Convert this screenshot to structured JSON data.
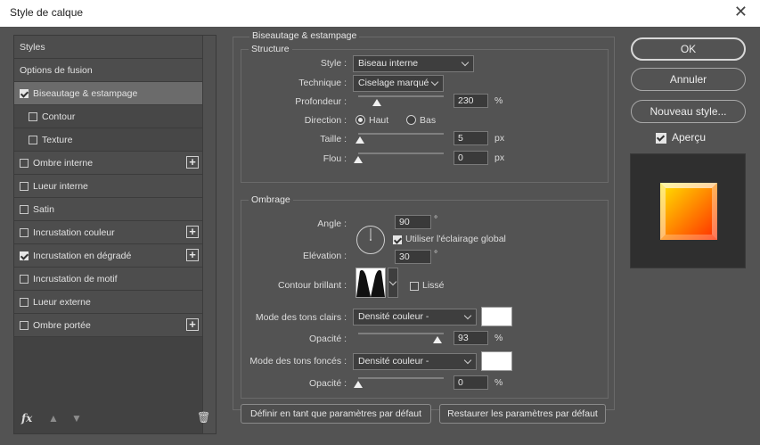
{
  "window": {
    "title": "Style de calque",
    "close_glyph": "✕"
  },
  "styles_list": {
    "items": [
      {
        "label": "Styles",
        "checkbox": false,
        "checked": false,
        "plus": false,
        "sub": false,
        "selected": false
      },
      {
        "label": "Options de fusion",
        "checkbox": false,
        "checked": false,
        "plus": false,
        "sub": false,
        "selected": false
      },
      {
        "label": "Biseautage & estampage",
        "checkbox": true,
        "checked": true,
        "plus": false,
        "sub": false,
        "selected": true
      },
      {
        "label": "Contour",
        "checkbox": true,
        "checked": false,
        "plus": false,
        "sub": true,
        "selected": false
      },
      {
        "label": "Texture",
        "checkbox": true,
        "checked": false,
        "plus": false,
        "sub": true,
        "selected": false
      },
      {
        "label": "Ombre interne",
        "checkbox": true,
        "checked": false,
        "plus": true,
        "sub": false,
        "selected": false
      },
      {
        "label": "Lueur interne",
        "checkbox": true,
        "checked": false,
        "plus": false,
        "sub": false,
        "selected": false
      },
      {
        "label": "Satin",
        "checkbox": true,
        "checked": false,
        "plus": false,
        "sub": false,
        "selected": false
      },
      {
        "label": "Incrustation couleur",
        "checkbox": true,
        "checked": false,
        "plus": true,
        "sub": false,
        "selected": false
      },
      {
        "label": "Incrustation en dégradé",
        "checkbox": true,
        "checked": true,
        "plus": true,
        "sub": false,
        "selected": false
      },
      {
        "label": "Incrustation de motif",
        "checkbox": true,
        "checked": false,
        "plus": false,
        "sub": false,
        "selected": false
      },
      {
        "label": "Lueur externe",
        "checkbox": true,
        "checked": false,
        "plus": false,
        "sub": false,
        "selected": false
      },
      {
        "label": "Ombre portée",
        "checkbox": true,
        "checked": false,
        "plus": true,
        "sub": false,
        "selected": false
      }
    ],
    "bottom_icons": {
      "fx": "fx",
      "up": "▲",
      "down": "▼",
      "trash": "🗑"
    }
  },
  "bevel": {
    "section_title": "Biseautage & estampage",
    "structure": {
      "legend": "Structure",
      "style_label": "Style :",
      "style_value": "Biseau interne",
      "technique_label": "Technique :",
      "technique_value": "Ciselage marqué",
      "depth_label": "Profondeur :",
      "depth_value": "230",
      "depth_unit": "%",
      "depth_slider_fraction": 0.22,
      "direction_label": "Direction :",
      "direction_up": "Haut",
      "direction_down": "Bas",
      "direction_selected": "Haut",
      "size_label": "Taille :",
      "size_value": "5",
      "size_unit": "px",
      "size_slider_fraction": 0.02,
      "soften_label": "Flou :",
      "soften_value": "0",
      "soften_unit": "px",
      "soften_slider_fraction": 0.0
    },
    "shading": {
      "legend": "Ombrage",
      "angle_label": "Angle :",
      "angle_value": "90",
      "angle_unit": "°",
      "global_light_label": "Utiliser l'éclairage global",
      "global_light_checked": true,
      "altitude_label": "Elévation :",
      "altitude_value": "30",
      "altitude_unit": "°",
      "gloss_contour_label": "Contour brillant :",
      "antialias_label": "Lissé",
      "antialias_checked": false,
      "highlight_mode_label": "Mode des tons clairs :",
      "highlight_mode_value": "Densité couleur -",
      "highlight_color": "#ffffff",
      "highlight_opacity_label": "Opacité :",
      "highlight_opacity_value": "93",
      "highlight_opacity_unit": "%",
      "highlight_opacity_fraction": 0.93,
      "shadow_mode_label": "Mode des tons foncés :",
      "shadow_mode_value": "Densité couleur -",
      "shadow_color": "#ffffff",
      "shadow_opacity_label": "Opacité :",
      "shadow_opacity_value": "0",
      "shadow_opacity_unit": "%",
      "shadow_opacity_fraction": 0.0
    },
    "make_default_label": "Définir en tant que paramètres par défaut",
    "reset_default_label": "Restaurer les paramètres par défaut"
  },
  "actions": {
    "ok_label": "OK",
    "cancel_label": "Annuler",
    "new_style_label": "Nouveau style...",
    "preview_label": "Aperçu",
    "preview_checked": true
  },
  "colors": {
    "dialog_bg": "#535353",
    "selected_row": "#6b6b6b",
    "preview_gradient_start": "#ffe600",
    "preview_gradient_end": "#ff2a00"
  }
}
